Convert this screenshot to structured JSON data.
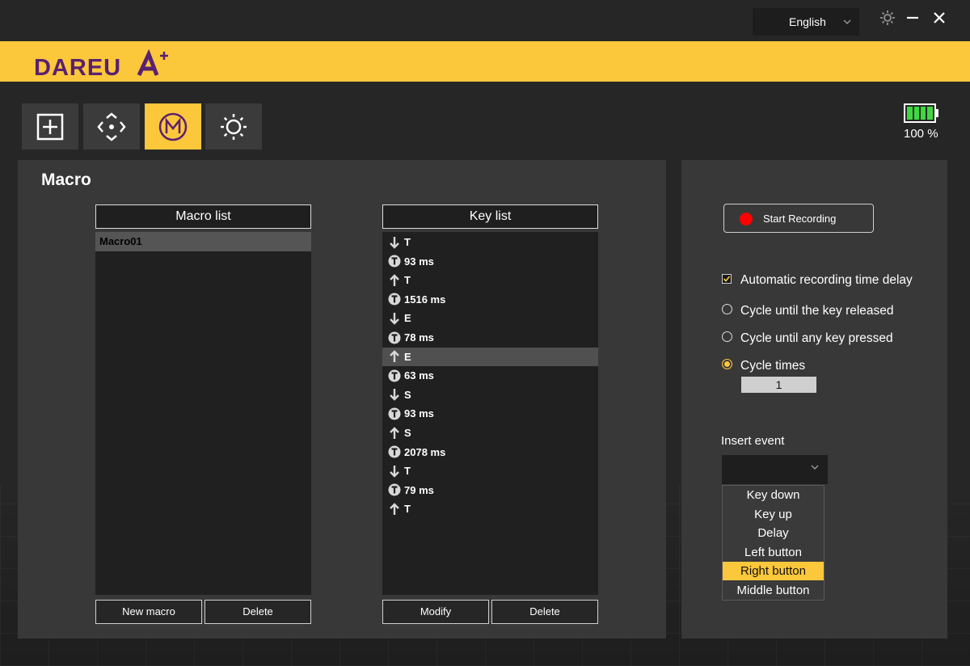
{
  "titlebar": {
    "language": "English",
    "icons": [
      "gear-icon",
      "minimize-icon",
      "close-icon"
    ]
  },
  "brand": {
    "logo_text": "DAREU"
  },
  "nav": {
    "items": [
      {
        "icon": "add-square-icon",
        "active": false
      },
      {
        "icon": "move-arrows-icon",
        "active": false
      },
      {
        "icon": "macro-m-icon",
        "active": true
      },
      {
        "icon": "brightness-sun-icon",
        "active": false
      }
    ],
    "accent": "#fbc73b"
  },
  "battery": {
    "percent": 100,
    "label": "100 %",
    "color": "#3fd93f"
  },
  "macro": {
    "title": "Macro",
    "macro_list_header": "Macro list",
    "macros": [
      "Macro01"
    ],
    "key_list_header": "Key list",
    "keys": [
      {
        "type": "down",
        "icon": "arrow-down-icon",
        "text": "T"
      },
      {
        "type": "delay",
        "icon": "timer-icon",
        "text": "93 ms"
      },
      {
        "type": "up",
        "icon": "arrow-up-icon",
        "text": "T"
      },
      {
        "type": "delay",
        "icon": "timer-icon",
        "text": "1516 ms"
      },
      {
        "type": "down",
        "icon": "arrow-down-icon",
        "text": "E"
      },
      {
        "type": "delay",
        "icon": "timer-icon",
        "text": "78 ms"
      },
      {
        "type": "up",
        "icon": "arrow-up-icon",
        "text": "E",
        "selected": true
      },
      {
        "type": "delay",
        "icon": "timer-icon",
        "text": "63 ms"
      },
      {
        "type": "down",
        "icon": "arrow-down-icon",
        "text": "S"
      },
      {
        "type": "delay",
        "icon": "timer-icon",
        "text": "93 ms"
      },
      {
        "type": "up",
        "icon": "arrow-up-icon",
        "text": "S"
      },
      {
        "type": "delay",
        "icon": "timer-icon",
        "text": "2078 ms"
      },
      {
        "type": "down",
        "icon": "arrow-down-icon",
        "text": "T"
      },
      {
        "type": "delay",
        "icon": "timer-icon",
        "text": "79 ms"
      },
      {
        "type": "up",
        "icon": "arrow-up-icon",
        "text": "T"
      }
    ],
    "new_macro_label": "New macro",
    "delete_macro_label": "Delete",
    "modify_label": "Modify",
    "delete_key_label": "Delete"
  },
  "recording": {
    "start_label": "Start Recording",
    "auto_delay_label": "Automatic recording time delay",
    "auto_delay_checked": true,
    "cycle_released_label": "Cycle until the key released",
    "cycle_any_label": "Cycle until any key pressed",
    "cycle_times_label": "Cycle times",
    "cycle_mode": "cycle_times",
    "cycle_times_value": "1",
    "insert_event_label": "Insert event",
    "insert_options": [
      "Key down",
      "Key up",
      "Delay",
      "Left button",
      "Right button",
      "Middle button"
    ],
    "insert_highlighted": "Right button"
  }
}
